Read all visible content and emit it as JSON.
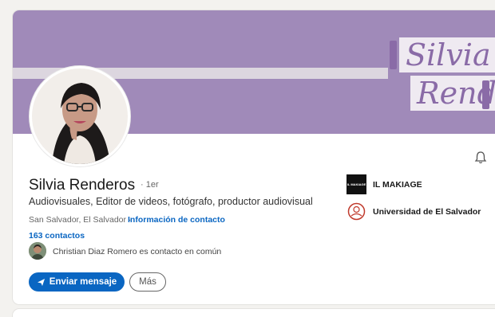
{
  "profile": {
    "name": "Silvia Renderos",
    "degree": "· 1er",
    "headline": "Audiovisuales, Editor de videos, fotógrafo, productor audiovisual",
    "location": "San Salvador, El Salvador ·",
    "contact_link": "Información de contacto",
    "connections": "163 contactos",
    "mutual": "Christian Diaz Romero es contacto en común"
  },
  "banner": {
    "word1": "Silvia",
    "word2": "Rend",
    "background_color": "#a08ab9"
  },
  "actions": {
    "message_label": "Enviar mensaje",
    "more_label": "Más"
  },
  "experience": [
    {
      "name": "IL MAKIAGE",
      "logo_text": "IL MAKIAGE",
      "icon": "company-logo"
    },
    {
      "name": "Universidad de El Salvador",
      "icon": "university-seal"
    }
  ],
  "colors": {
    "accent": "#0a66c2"
  }
}
